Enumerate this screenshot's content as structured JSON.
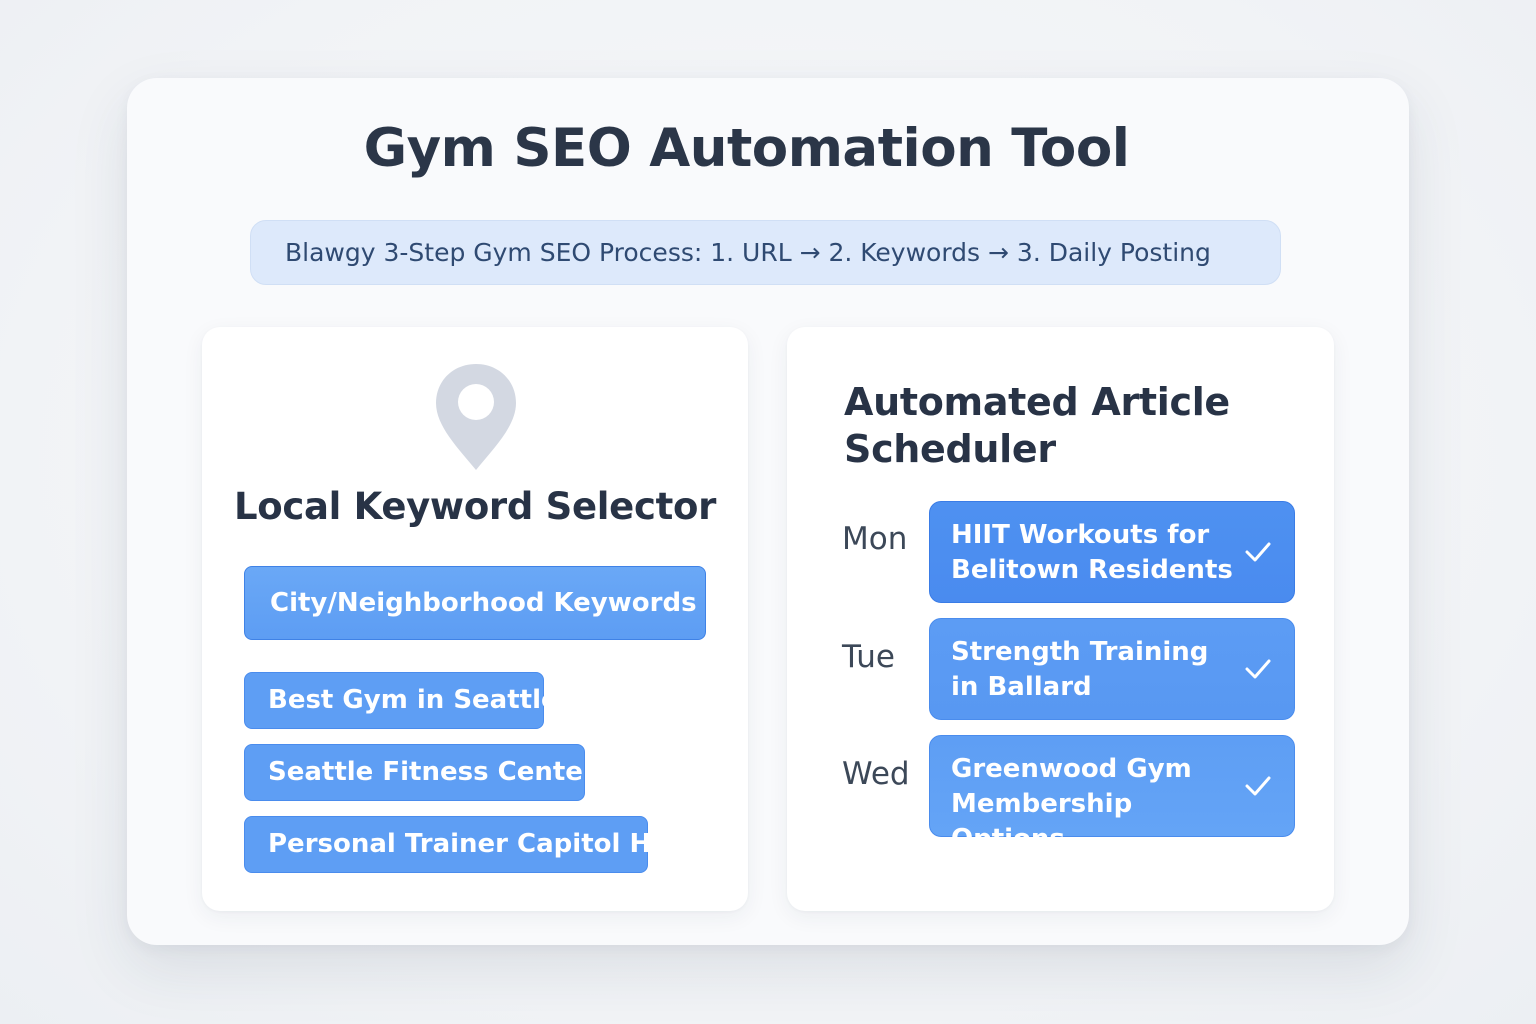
{
  "header": {
    "title": "Gym SEO Automation Tool",
    "process_banner": "Blawgy 3-Step Gym SEO Process: 1. URL → 2. Keywords → 3. Daily Posting"
  },
  "keyword_selector": {
    "icon": "map-pin-icon",
    "heading": "Local Keyword Selector",
    "category": "City/Neighborhood Keywords",
    "keywords": [
      "Best Gym in Seattle",
      "Seattle Fitness Center",
      "Personal Trainer Capitol Hill"
    ]
  },
  "scheduler": {
    "heading": "Automated Article Scheduler",
    "entries": [
      {
        "day": "Mon",
        "title_line1": "HIIT Workouts for",
        "title_line2": "Belitown Residents",
        "status_icon": "check-icon"
      },
      {
        "day": "Tue",
        "title_line1": "Strength Training",
        "title_line2": "in Ballard",
        "status_icon": "check-icon"
      },
      {
        "day": "Wed",
        "title_line1": "Greenwood Gym",
        "title_line2": "Membership Options",
        "status_icon": "check-icon"
      }
    ]
  },
  "colors": {
    "background": "#f2f4f7",
    "title_text": "#2b3648",
    "banner_bg": "#dde9fb",
    "accent_blue": "#5e9ef4",
    "accent_blue_dark": "#4a8bef"
  }
}
